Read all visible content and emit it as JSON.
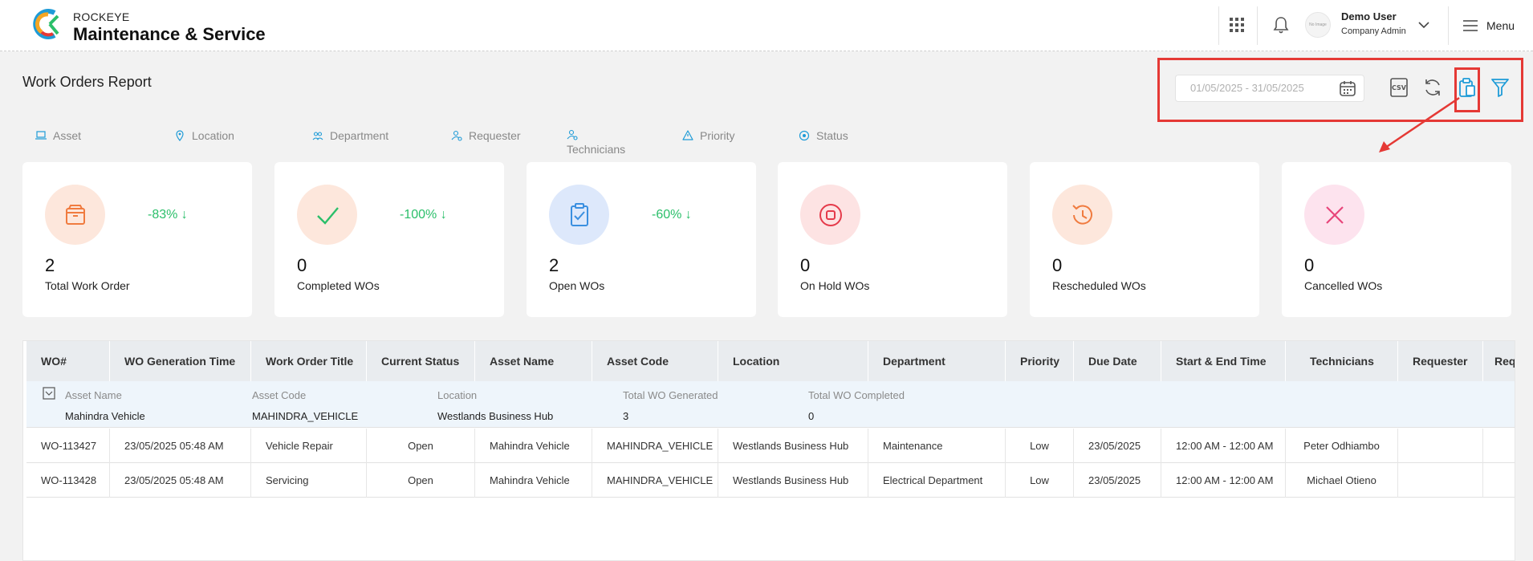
{
  "header": {
    "brand_small": "ROCKEYE",
    "brand_big": "Maintenance & Service",
    "avatar_text": "No Image",
    "user_name": "Demo User",
    "user_role": "Company Admin",
    "menu_label": "Menu"
  },
  "page": {
    "title": "Work Orders Report"
  },
  "toolbar": {
    "date_range_placeholder": "01/05/2025 - 31/05/2025",
    "csv_label": "CSV"
  },
  "filters": [
    {
      "label": "Asset",
      "icon": "laptop-icon"
    },
    {
      "label": "Location",
      "icon": "location-pin-icon"
    },
    {
      "label": "Department",
      "icon": "people-icon"
    },
    {
      "label": "Requester",
      "icon": "user-gear-icon"
    },
    {
      "label": "Technicians",
      "icon": "user-gear-icon"
    },
    {
      "label": "Priority",
      "icon": "warning-triangle-icon"
    },
    {
      "label": "Status",
      "icon": "status-circle-icon"
    }
  ],
  "cards": [
    {
      "value": "2",
      "label": "Total Work Order",
      "change": "-83% ↓",
      "icon": "box-icon",
      "color": "#f07b3f",
      "bg": "#fde7dc"
    },
    {
      "value": "0",
      "label": "Completed WOs",
      "change": "-100% ↓",
      "icon": "check-icon",
      "color": "#2bbf6a",
      "bg": "#fde7dc"
    },
    {
      "value": "2",
      "label": "Open WOs",
      "change": "-60% ↓",
      "icon": "clipboard-check-icon",
      "color": "#3a8fe0",
      "bg": "#dde8fb"
    },
    {
      "value": "0",
      "label": "On Hold WOs",
      "change": "",
      "icon": "stop-icon",
      "color": "#e53a4a",
      "bg": "#fde3e3"
    },
    {
      "value": "0",
      "label": "Rescheduled WOs",
      "change": "",
      "icon": "history-icon",
      "color": "#f07b3f",
      "bg": "#fde7dc"
    },
    {
      "value": "0",
      "label": "Cancelled WOs",
      "change": "",
      "icon": "cross-icon",
      "color": "#e8457a",
      "bg": "#fde3ee"
    }
  ],
  "table": {
    "columns": [
      "WO#",
      "WO Generation Time",
      "Work Order Title",
      "Current Status",
      "Asset Name",
      "Asset Code",
      "Location",
      "Department",
      "Priority",
      "Due Date",
      "Start & End Time",
      "Technicians",
      "Requester",
      "Req"
    ],
    "group": {
      "labels": [
        "Asset Name",
        "Asset Code",
        "Location",
        "Total WO Generated",
        "Total WO Completed"
      ],
      "values": [
        "Mahindra Vehicle",
        "MAHINDRA_VEHICLE",
        "Westlands Business Hub",
        "3",
        "0"
      ]
    },
    "rows": [
      [
        "WO-113427",
        "23/05/2025 05:48 AM",
        "Vehicle Repair",
        "Open",
        "Mahindra Vehicle",
        "MAHINDRA_VEHICLE",
        "Westlands Business Hub",
        "Maintenance",
        "Low",
        "23/05/2025",
        "12:00 AM - 12:00 AM",
        "Peter Odhiambo",
        "",
        ""
      ],
      [
        "WO-113428",
        "23/05/2025 05:48 AM",
        "Servicing",
        "Open",
        "Mahindra Vehicle",
        "MAHINDRA_VEHICLE",
        "Westlands Business Hub",
        "Electrical Department",
        "Low",
        "23/05/2025",
        "12:00 AM - 12:00 AM",
        "Michael Otieno",
        "",
        ""
      ]
    ]
  },
  "colors": {
    "accent": "#1e9bd7",
    "highlight": "#e53935",
    "positive": "#2bbf6a"
  }
}
